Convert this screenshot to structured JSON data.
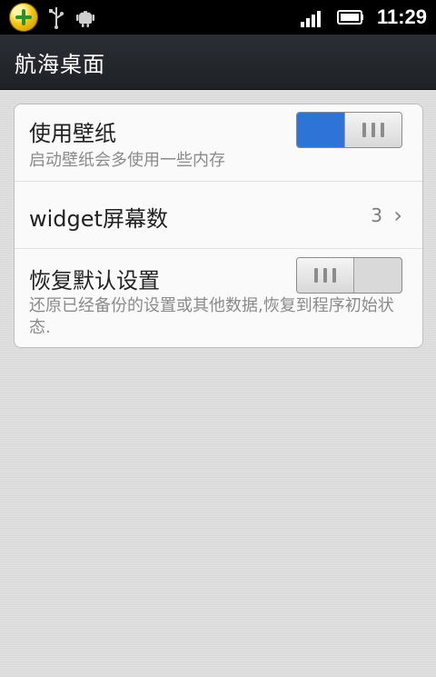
{
  "statusbar": {
    "time": "11:29",
    "icons": [
      "app-badge",
      "usb-icon",
      "android-debug-icon",
      "signal-icon",
      "battery-icon"
    ]
  },
  "header": {
    "title": "航海桌面"
  },
  "settings": {
    "items": [
      {
        "label": "使用壁纸",
        "summary": "启动壁纸会多使用一些内存",
        "toggle": "on"
      },
      {
        "label": "widget屏幕数",
        "value": "3"
      },
      {
        "label": "恢复默认设置",
        "summary": "还原已经备份的设置或其他数据,恢复到程序初始状态.",
        "toggle": "off"
      }
    ]
  },
  "colors": {
    "accent": "#2e74d6",
    "titlebar": "#2b2f35",
    "panel": "#fafafa",
    "background": "#dcdcdc"
  }
}
